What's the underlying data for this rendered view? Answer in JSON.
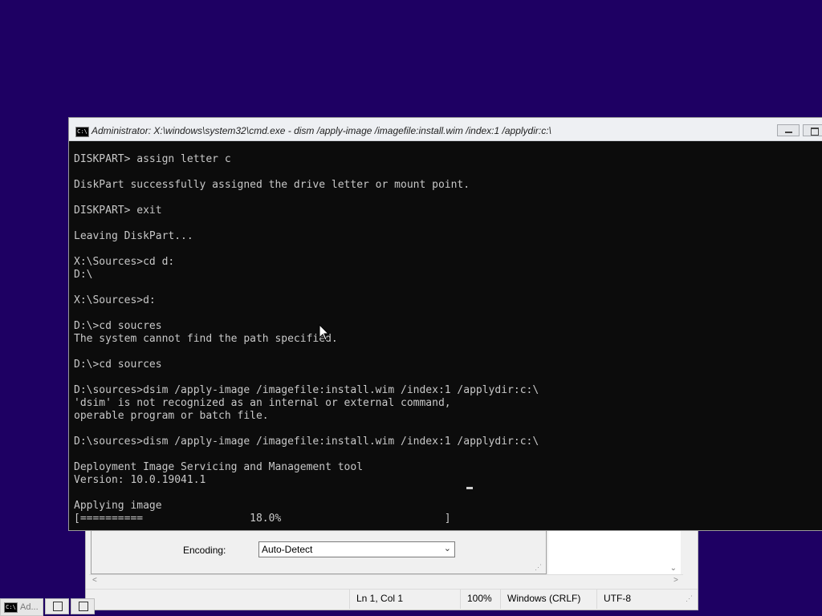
{
  "cmd_window": {
    "title": "Administrator: X:\\windows\\system32\\cmd.exe - dism  /apply-image /imagefile:install.wim /index:1 /applydir:c:\\",
    "icon": "cmd-icon",
    "lines": [
      "DISKPART> assign letter c",
      "",
      "DiskPart successfully assigned the drive letter or mount point.",
      "",
      "DISKPART> exit",
      "",
      "Leaving DiskPart...",
      "",
      "X:\\Sources>cd d:",
      "D:\\",
      "",
      "X:\\Sources>d:",
      "",
      "D:\\>cd soucres",
      "The system cannot find the path specified.",
      "",
      "D:\\>cd sources",
      "",
      "D:\\sources>dsim /apply-image /imagefile:install.wim /index:1 /applydir:c:\\",
      "'dsim' is not recognized as an internal or external command,",
      "operable program or batch file.",
      "",
      "D:\\sources>dism /apply-image /imagefile:install.wim /index:1 /applydir:c:\\",
      "",
      "Deployment Image Servicing and Management tool",
      "Version: 10.0.19041.1",
      "",
      "Applying image",
      "[==========                 18.0%                          ]"
    ],
    "progress_percent": 18.0
  },
  "background_window": {
    "encoding_label": "Encoding:",
    "encoding_value": "Auto-Detect",
    "status": {
      "position": "Ln 1, Col 1",
      "zoom": "100%",
      "line_ending": "Windows (CRLF)",
      "charset": "UTF-8"
    }
  },
  "taskbar": {
    "item_label": "Ad..."
  }
}
